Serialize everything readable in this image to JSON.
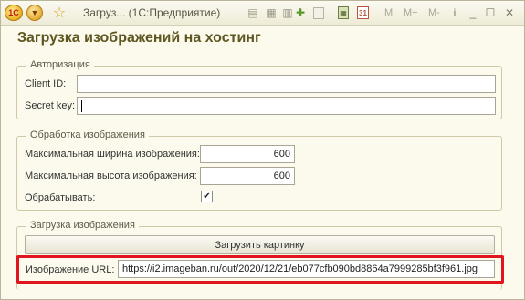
{
  "window": {
    "title": "Загруз...    (1С:Предприятие)",
    "logo_text": "1С",
    "toolbar_m_labels": [
      "M",
      "M+",
      "M-"
    ]
  },
  "form": {
    "title": "Загрузка изображений на хостинг"
  },
  "auth": {
    "group_title": "Авторизация",
    "client_id_label": "Client ID:",
    "client_id_value": "",
    "secret_key_label": "Secret key:",
    "secret_key_value": ""
  },
  "processing": {
    "group_title": "Обработка изображения",
    "max_width_label": "Максимальная ширина изображения:",
    "max_width_value": "600",
    "max_height_label": "Максимальная высота изображения:",
    "max_height_value": "600",
    "process_label": "Обрабатывать:",
    "process_checked": true
  },
  "upload": {
    "group_title": "Загрузка изображения",
    "upload_button_label": "Загрузить картинку",
    "url_label": "Изображение URL:",
    "url_value": "https://i2.imageban.ru/out/2020/12/21/eb077cfb090bd8864a7999285bf3f961.jpg"
  },
  "colors": {
    "highlight": "#e0161e",
    "form_title": "#5d5620",
    "background": "#fbfaec"
  }
}
